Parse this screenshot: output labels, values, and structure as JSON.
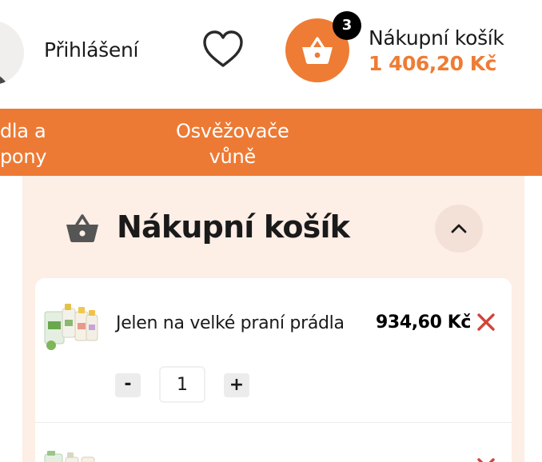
{
  "header": {
    "login_label": "Přihlášení",
    "cart": {
      "count": "3",
      "title": "Nákupní košík",
      "total": "1 406,20 Kč"
    }
  },
  "nav": {
    "items": [
      {
        "lines": [
          "dla a",
          "pony"
        ]
      },
      {
        "lines": [
          "Osvěžovače",
          "vůně"
        ]
      }
    ]
  },
  "cart_panel": {
    "title": "Nákupní košík",
    "items": [
      {
        "name": "Jelen na velké praní prádla",
        "price": "934,60 Kč",
        "quantity": "1",
        "minus_label": "-",
        "plus_label": "+"
      }
    ]
  },
  "colors": {
    "accent": "#ee7c34",
    "nav_bg": "#ed7a34",
    "panel_bg": "#fdeee6",
    "remove": "#d0443a",
    "badge": "#000000"
  },
  "icons": {
    "user": "user-icon",
    "wishlist": "heart-icon",
    "cart": "basket-icon",
    "collapse": "chevron-up-icon",
    "remove": "close-icon"
  }
}
